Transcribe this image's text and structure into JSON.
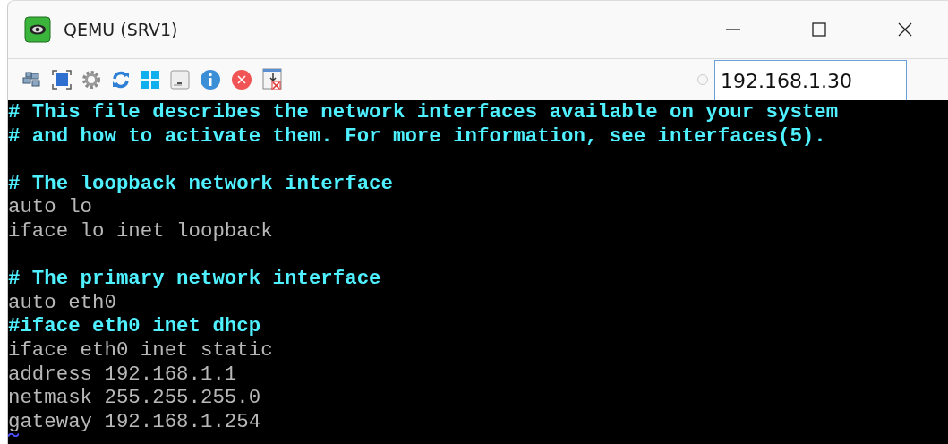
{
  "window": {
    "title": "QEMU (SRV1)"
  },
  "toolbar": {
    "address": "192.168.1.30"
  },
  "terminal": {
    "lines": [
      {
        "kind": "comment",
        "text": "# This file describes the network interfaces available on your system"
      },
      {
        "kind": "comment",
        "text": "# and how to activate them. For more information, see interfaces(5)."
      },
      {
        "kind": "blank"
      },
      {
        "kind": "comment",
        "text": "# The loopback network interface"
      },
      {
        "kind": "plain",
        "text": "auto lo"
      },
      {
        "kind": "plain",
        "text": "iface lo inet loopback"
      },
      {
        "kind": "blank"
      },
      {
        "kind": "comment",
        "text": "# The primary network interface"
      },
      {
        "kind": "plain",
        "text": "auto eth0"
      },
      {
        "kind": "comment",
        "text": "#iface eth0 inet dhcp"
      },
      {
        "kind": "plain",
        "text": "iface eth0 inet static"
      },
      {
        "kind": "plain",
        "text": "address 192.168.1.1"
      },
      {
        "kind": "plain",
        "text": "netmask 255.255.255.0"
      },
      {
        "kind": "plain",
        "text": "gateway 192.168.1.254"
      },
      {
        "kind": "tilde"
      }
    ]
  }
}
